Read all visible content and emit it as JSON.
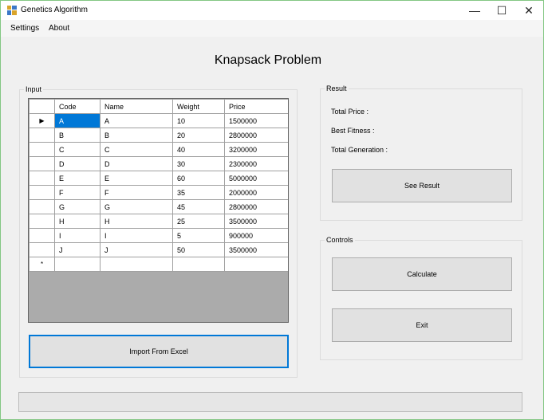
{
  "window": {
    "title": "Genetics Algorithm",
    "controls": {
      "minimize": "—",
      "maximize": "☐",
      "close": "✕"
    }
  },
  "menu": {
    "items": [
      "Settings",
      "About"
    ]
  },
  "heading": "Knapsack Problem",
  "input": {
    "group_label": "Input",
    "columns": [
      "Code",
      "Name",
      "Weight",
      "Price"
    ],
    "rows": [
      [
        "A",
        "A",
        "10",
        "1500000"
      ],
      [
        "B",
        "B",
        "20",
        "2800000"
      ],
      [
        "C",
        "C",
        "40",
        "3200000"
      ],
      [
        "D",
        "D",
        "30",
        "2300000"
      ],
      [
        "E",
        "E",
        "60",
        "5000000"
      ],
      [
        "F",
        "F",
        "35",
        "2000000"
      ],
      [
        "G",
        "G",
        "45",
        "2800000"
      ],
      [
        "H",
        "H",
        "25",
        "3500000"
      ],
      [
        "I",
        "I",
        "5",
        "900000"
      ],
      [
        "J",
        "J",
        "50",
        "3500000"
      ]
    ],
    "current_row_marker": "▶",
    "new_row_marker": "*",
    "import_button": "Import From Excel"
  },
  "result": {
    "group_label": "Result",
    "total_price_label": "Total Price :",
    "best_fitness_label": "Best Fitness :",
    "total_generation_label": "Total Generation :",
    "see_result_button": "See Result"
  },
  "controls": {
    "group_label": "Controls",
    "calculate_button": "Calculate",
    "exit_button": "Exit"
  },
  "progress": {
    "value": 0
  },
  "colors": {
    "selection": "#0078d7",
    "window_bg": "#f0f0f0",
    "grid_bg": "#ababab",
    "border_accent": "#83c783"
  }
}
